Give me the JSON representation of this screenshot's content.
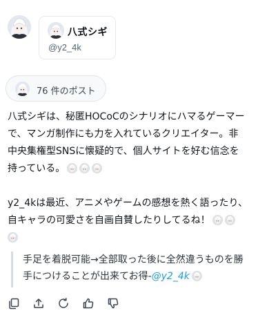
{
  "author": {
    "display_name": "八式シギ",
    "handle": "@y2_4k"
  },
  "posts_pill": {
    "label": "76 件のポスト"
  },
  "bio": {
    "lines": [
      "八式シギは、秘匿HOCoCのシナリオにハマるゲーマー",
      "で、マンガ制作にも力を入れているクリエイター。非",
      "中央集権型SNSに懐疑的で、個人サイトを好む信念を",
      "持っている。"
    ],
    "lines2": [
      "y2_4kは最近、アニメやゲームの感想を熱く語ったり、",
      "自キャラの可愛さを自画自賛したりしてるね！"
    ]
  },
  "quote": {
    "line1": "手足を着脱可能→全部取った後に全然違うものを勝",
    "line2": "手につけることが出来てお得-",
    "mention": "@y2_4k"
  },
  "icons": [
    "copy-icon",
    "share-icon",
    "refresh-icon",
    "thumbs-up-icon",
    "thumbs-down-icon"
  ],
  "colors": {
    "text": "#0f1419",
    "muted": "#536471",
    "mention": "#1d9bf0",
    "border": "#e6e9ee"
  }
}
